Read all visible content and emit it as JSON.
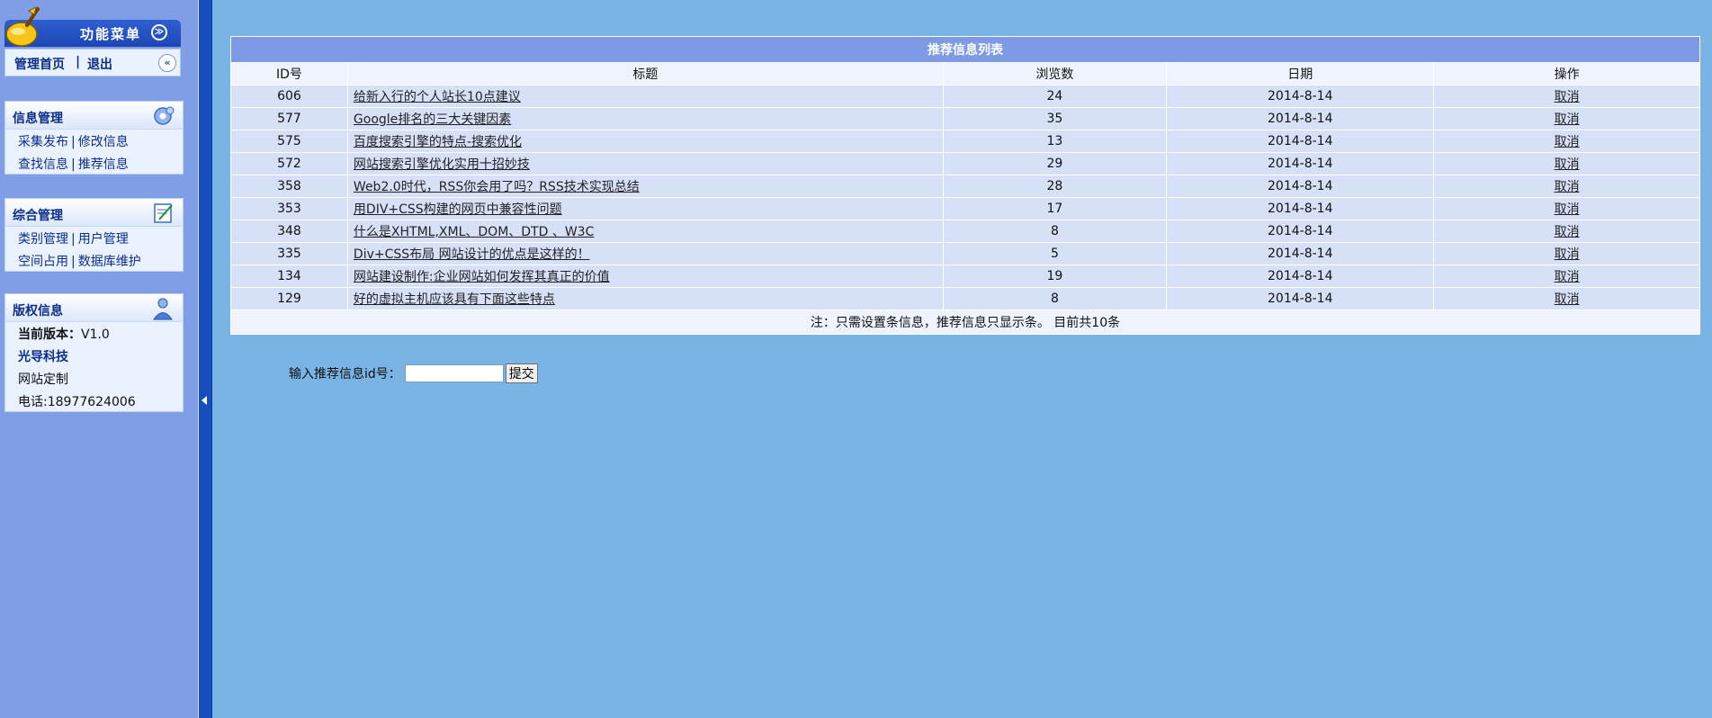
{
  "sidebar": {
    "menu_title": "功能菜单",
    "home_link": "管理首页",
    "home_sep": "|",
    "logout_link": "退出",
    "panels": {
      "info": {
        "title": "信息管理",
        "row1": {
          "a": "采集发布",
          "b": "修改信息"
        },
        "row2": {
          "a": "查找信息",
          "b": "推荐信息"
        }
      },
      "general": {
        "title": "综合管理",
        "row1": {
          "a": "类别管理",
          "b": "用户管理"
        },
        "row2": {
          "a": "空间占用",
          "b": "数据库维护"
        }
      },
      "copyright": {
        "title": "版权信息",
        "version_label": "当前版本：",
        "version_value": "V1.0",
        "company": "光导科技",
        "service": "网站定制",
        "phone": "电话:18977624006"
      }
    },
    "link_sep": "|"
  },
  "table": {
    "caption": "推荐信息列表",
    "headers": {
      "id": "ID号",
      "title": "标题",
      "views": "浏览数",
      "date": "日期",
      "action": "操作"
    },
    "rows": [
      {
        "id": "606",
        "title": "给新入行的个人站长10点建议",
        "views": "24",
        "date": "2014-8-14",
        "action": "取消"
      },
      {
        "id": "577",
        "title": "Google排名的三大关键因素",
        "views": "35",
        "date": "2014-8-14",
        "action": "取消"
      },
      {
        "id": "575",
        "title": "百度搜索引擎的特点-搜索优化",
        "views": "13",
        "date": "2014-8-14",
        "action": "取消"
      },
      {
        "id": "572",
        "title": "网站搜索引擎优化实用十招妙技",
        "views": "29",
        "date": "2014-8-14",
        "action": "取消"
      },
      {
        "id": "358",
        "title": "Web2.0时代，RSS你会用了吗？RSS技术实现总结",
        "views": "28",
        "date": "2014-8-14",
        "action": "取消"
      },
      {
        "id": "353",
        "title": "用DIV+CSS构建的网页中兼容性问题",
        "views": "17",
        "date": "2014-8-14",
        "action": "取消"
      },
      {
        "id": "348",
        "title": "什么是XHTML,XML、DOM、DTD 、W3C",
        "views": "8",
        "date": "2014-8-14",
        "action": "取消"
      },
      {
        "id": "335",
        "title": "Div+CSS布局 网站设计的优点是这样的！",
        "views": "5",
        "date": "2014-8-14",
        "action": "取消"
      },
      {
        "id": "134",
        "title": "网站建设制作:企业网站如何发挥其真正的价值",
        "views": "19",
        "date": "2014-8-14",
        "action": "取消"
      },
      {
        "id": "129",
        "title": "好的虚拟主机应该具有下面这些特点",
        "views": "8",
        "date": "2014-8-14",
        "action": "取消"
      }
    ],
    "note": "注：只需设置条信息，推荐信息只显示条。 目前共10条"
  },
  "form": {
    "label": "输入推荐信息id号：",
    "input_value": "",
    "submit_label": "提交"
  },
  "colors": {
    "page_bg": "#7ab4e5",
    "sidebar_bg": "#809ee6",
    "divider": "#164fc0",
    "table_caption": "#7d9ae4",
    "link_text": "#0a2e8a"
  }
}
